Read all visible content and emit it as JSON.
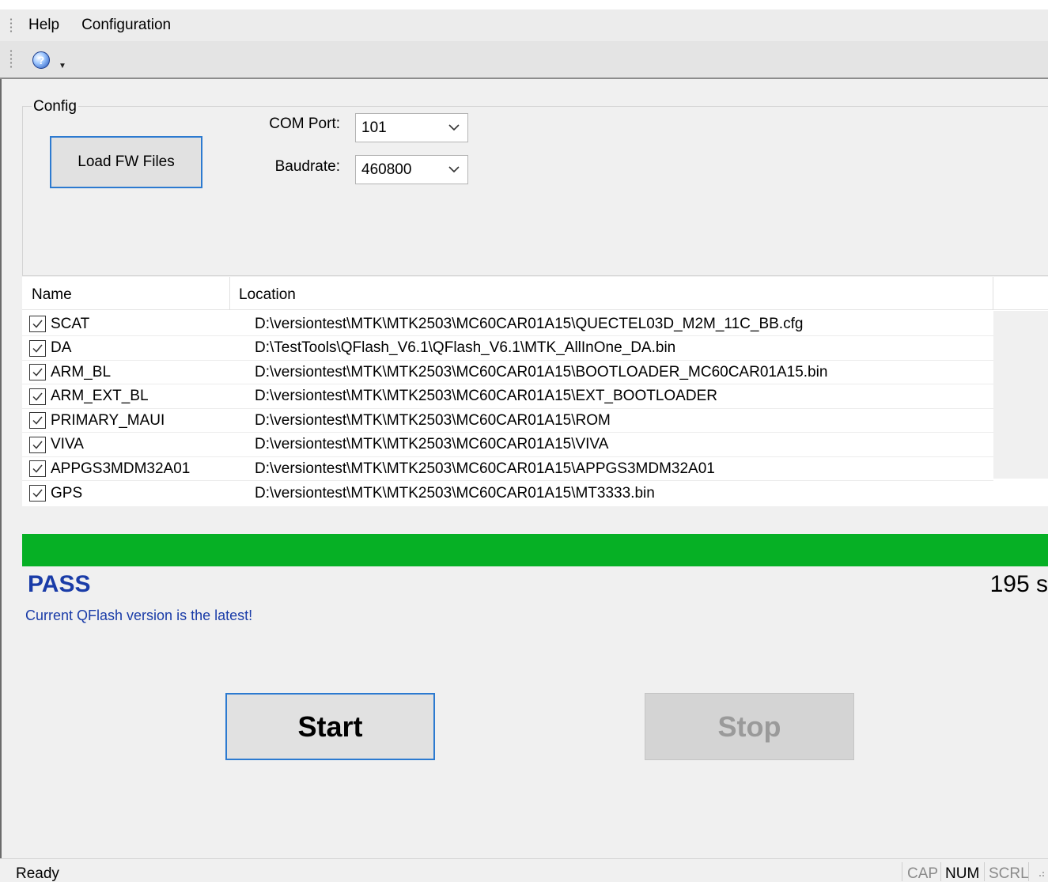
{
  "menu": {
    "items": [
      "Help",
      "Configuration"
    ]
  },
  "toolbar": {
    "help_icon": "help-icon"
  },
  "config": {
    "group_label": "Config",
    "load_button": "Load FW Files",
    "com_port_label": "COM Port:",
    "com_port_value": "101",
    "baudrate_label": "Baudrate:",
    "baudrate_value": "460800"
  },
  "file_list": {
    "columns": [
      "Name",
      "Location"
    ],
    "rows": [
      {
        "checked": true,
        "name": "SCAT",
        "location": "D:\\versiontest\\MTK\\MTK2503\\MC60CAR01A15\\QUECTEL03D_M2M_11C_BB.cfg"
      },
      {
        "checked": true,
        "name": "DA",
        "location": "D:\\TestTools\\QFlash_V6.1\\QFlash_V6.1\\MTK_AllInOne_DA.bin"
      },
      {
        "checked": true,
        "name": "ARM_BL",
        "location": "D:\\versiontest\\MTK\\MTK2503\\MC60CAR01A15\\BOOTLOADER_MC60CAR01A15.bin"
      },
      {
        "checked": true,
        "name": "ARM_EXT_BL",
        "location": "D:\\versiontest\\MTK\\MTK2503\\MC60CAR01A15\\EXT_BOOTLOADER"
      },
      {
        "checked": true,
        "name": "PRIMARY_MAUI",
        "location": "D:\\versiontest\\MTK\\MTK2503\\MC60CAR01A15\\ROM"
      },
      {
        "checked": true,
        "name": "VIVA",
        "location": "D:\\versiontest\\MTK\\MTK2503\\MC60CAR01A15\\VIVA"
      },
      {
        "checked": true,
        "name": "APPGS3MDM32A01",
        "location": "D:\\versiontest\\MTK\\MTK2503\\MC60CAR01A15\\APPGS3MDM32A01"
      },
      {
        "checked": true,
        "name": "GPS",
        "location": "D:\\versiontest\\MTK\\MTK2503\\MC60CAR01A15\\MT3333.bin"
      }
    ]
  },
  "progress": {
    "percent": 100,
    "color": "#06b025"
  },
  "result": {
    "status": "PASS",
    "elapsed": "195 s",
    "message": "Current QFlash version is the latest!"
  },
  "actions": {
    "start": "Start",
    "stop": "Stop",
    "stop_enabled": false
  },
  "statusbar": {
    "text": "Ready",
    "indicators": [
      {
        "label": "CAP",
        "active": false
      },
      {
        "label": "NUM",
        "active": true
      },
      {
        "label": "SCRL",
        "active": false
      }
    ]
  },
  "colors": {
    "accent": "#2c7ad0",
    "status_text": "#1a3ca8"
  }
}
